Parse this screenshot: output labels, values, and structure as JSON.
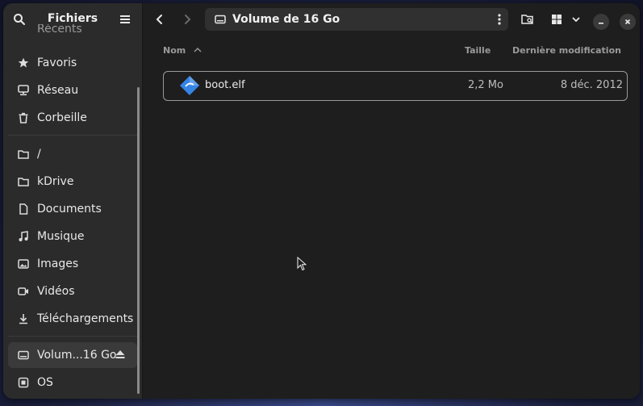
{
  "sidebar": {
    "title": "Fichiers",
    "partial_item": "Récents",
    "items": [
      {
        "label": "Favoris",
        "icon": "star-icon"
      },
      {
        "label": "Réseau",
        "icon": "network-icon"
      },
      {
        "label": "Corbeille",
        "icon": "trash-icon"
      },
      {
        "label": "/",
        "icon": "folder-icon"
      },
      {
        "label": "kDrive",
        "icon": "folder-icon"
      },
      {
        "label": "Documents",
        "icon": "document-icon"
      },
      {
        "label": "Musique",
        "icon": "music-icon"
      },
      {
        "label": "Images",
        "icon": "image-icon"
      },
      {
        "label": "Vidéos",
        "icon": "video-icon"
      },
      {
        "label": "Téléchargements",
        "icon": "download-icon"
      },
      {
        "label": "Volum...16 Go",
        "icon": "drive-icon"
      },
      {
        "label": "OS",
        "icon": "disk-icon"
      }
    ]
  },
  "pathbar": {
    "label": "Volume de 16 Go",
    "icon": "drive-icon"
  },
  "columns": {
    "name": "Nom",
    "size": "Taille",
    "modified": "Dernière modification"
  },
  "files": [
    {
      "name": "boot.elf",
      "size": "2,2 Mo",
      "modified": "8 déc. 2012",
      "icon": "executable-icon"
    }
  ],
  "colors": {
    "window_bg": "#1e1e1e",
    "sidebar_bg": "#2b2b2b",
    "accent": "#3584e4"
  }
}
